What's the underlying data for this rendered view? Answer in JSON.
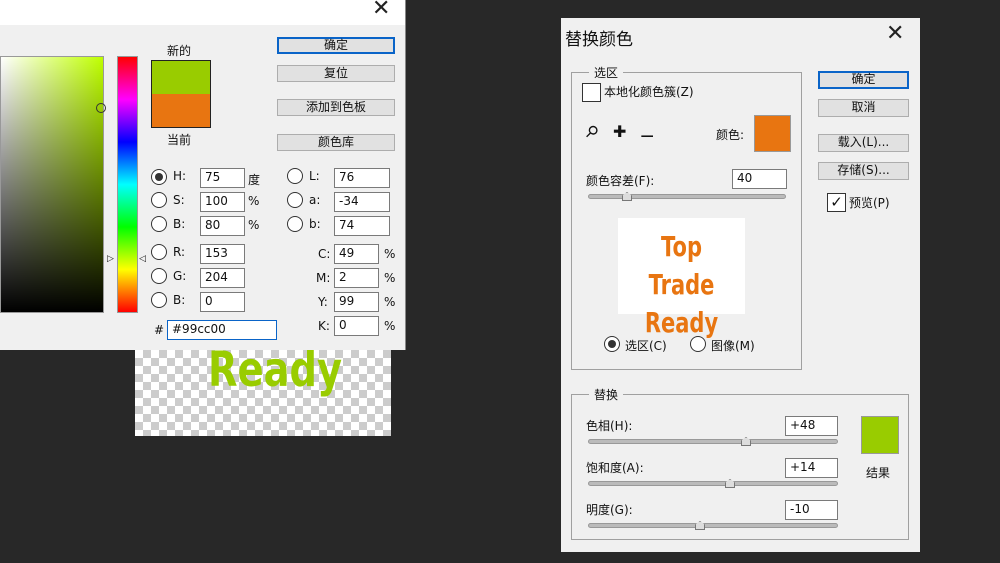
{
  "color_picker": {
    "new_label": "新的",
    "current_label": "当前",
    "new_color": "#99cc00",
    "current_color": "#e87511",
    "buttons": {
      "ok": "确定",
      "reset": "复位",
      "add_swatch": "添加到色板",
      "libraries": "颜色库"
    },
    "hsb": [
      {
        "label": "H:",
        "value": "75",
        "unit": "度",
        "selected": true
      },
      {
        "label": "S:",
        "value": "100",
        "unit": "%"
      },
      {
        "label": "B:",
        "value": "80",
        "unit": "%"
      }
    ],
    "rgb": [
      {
        "label": "R:",
        "value": "153"
      },
      {
        "label": "G:",
        "value": "204"
      },
      {
        "label": "B:",
        "value": "0"
      }
    ],
    "lab": [
      {
        "label": "L:",
        "value": "76"
      },
      {
        "label": "a:",
        "value": "-34"
      },
      {
        "label": "b:",
        "value": "74"
      }
    ],
    "cmyk": [
      {
        "label": "C:",
        "value": "49",
        "unit": "%"
      },
      {
        "label": "M:",
        "value": "2",
        "unit": "%"
      },
      {
        "label": "Y:",
        "value": "99",
        "unit": "%"
      },
      {
        "label": "K:",
        "value": "0",
        "unit": "%"
      }
    ],
    "hex_label": "#",
    "hex_value": "#99cc00"
  },
  "canvas": {
    "text": "Ready",
    "text_color": "#99cc00"
  },
  "replace_color": {
    "title": "替换颜色",
    "selection_group": "选区",
    "localized_clusters": "本地化颜色簇(Z)",
    "color_label": "颜色:",
    "color": "#e87511",
    "fuzziness_label": "颜色容差(F):",
    "fuzziness": "40",
    "fuzziness_value": 40,
    "preview_lines": [
      "Top Trade",
      "Ready"
    ],
    "view_selection": "选区(C)",
    "view_image": "图像(M)",
    "buttons": {
      "ok": "确定",
      "cancel": "取消",
      "load": "载入(L)...",
      "save": "存储(S)..."
    },
    "preview_label": "预览(P)",
    "preview_checked": true,
    "replace_group": "替换",
    "hue_label": "色相(H):",
    "hue": "+48",
    "saturation_label": "饱和度(A):",
    "saturation": "+14",
    "lightness_label": "明度(G):",
    "lightness": "-10",
    "result_label": "结果",
    "result_color": "#99cc00"
  }
}
